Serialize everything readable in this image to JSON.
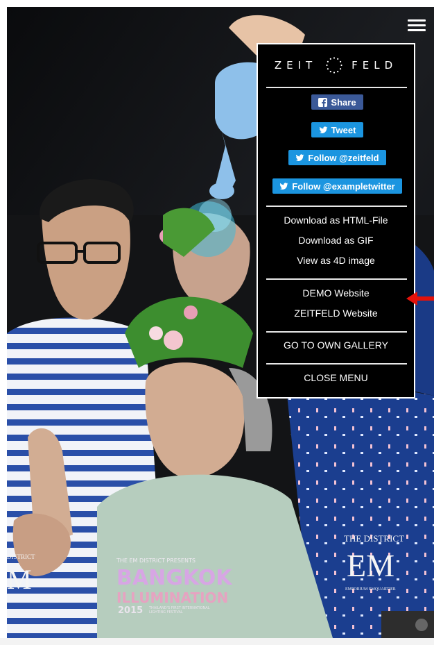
{
  "menu": {
    "logo": {
      "left": "ZEIT",
      "right": "FELD"
    },
    "social": {
      "share": "Share",
      "tweet": "Tweet",
      "follow_zeitfeld": "Follow @zeitfeld",
      "follow_example": "Follow @exampletwitter"
    },
    "downloads": {
      "html": "Download as HTML-File",
      "gif": "Download as GIF",
      "view4d": "View as 4D image"
    },
    "websites": {
      "demo": "DEMO Website",
      "zeitfeld": "ZEITFELD Website"
    },
    "gallery": "GO TO OWN GALLERY",
    "close": "CLOSE MENU"
  },
  "photo": {
    "poster_text": {
      "presenter": "THE EM DISTRICT PRESENTS",
      "title_1": "BANGKOK",
      "title_2": "ILLUMINATION",
      "year": "2015",
      "tagline_1": "THAILAND'S FIRST INTERNATIONAL",
      "tagline_2": "LIGHTING FESTIVAL"
    },
    "em_logo": {
      "small": "THE DISTRICT",
      "big": "EM",
      "sub": "EMPORIUM  EMQUARTIER"
    },
    "left_em": {
      "small": "DISTRICT",
      "big": "M"
    }
  },
  "colors": {
    "facebook": "#3b5998",
    "twitter": "#1b95e0",
    "arrow": "#e3120b"
  }
}
